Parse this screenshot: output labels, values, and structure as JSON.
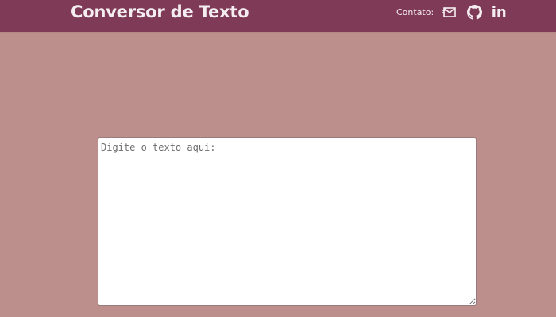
{
  "header": {
    "title": "Conversor de Texto",
    "contact_label": "Contato:",
    "links": [
      {
        "icon": "mail-icon"
      },
      {
        "icon": "github-icon"
      },
      {
        "icon": "linkedin-icon",
        "text": "in"
      }
    ]
  },
  "editor": {
    "placeholder": "Digite o texto aqui:",
    "value": ""
  },
  "colors": {
    "background": "#bc8e8c",
    "header": "#7f3a57",
    "header_text": "#f5eef1"
  }
}
